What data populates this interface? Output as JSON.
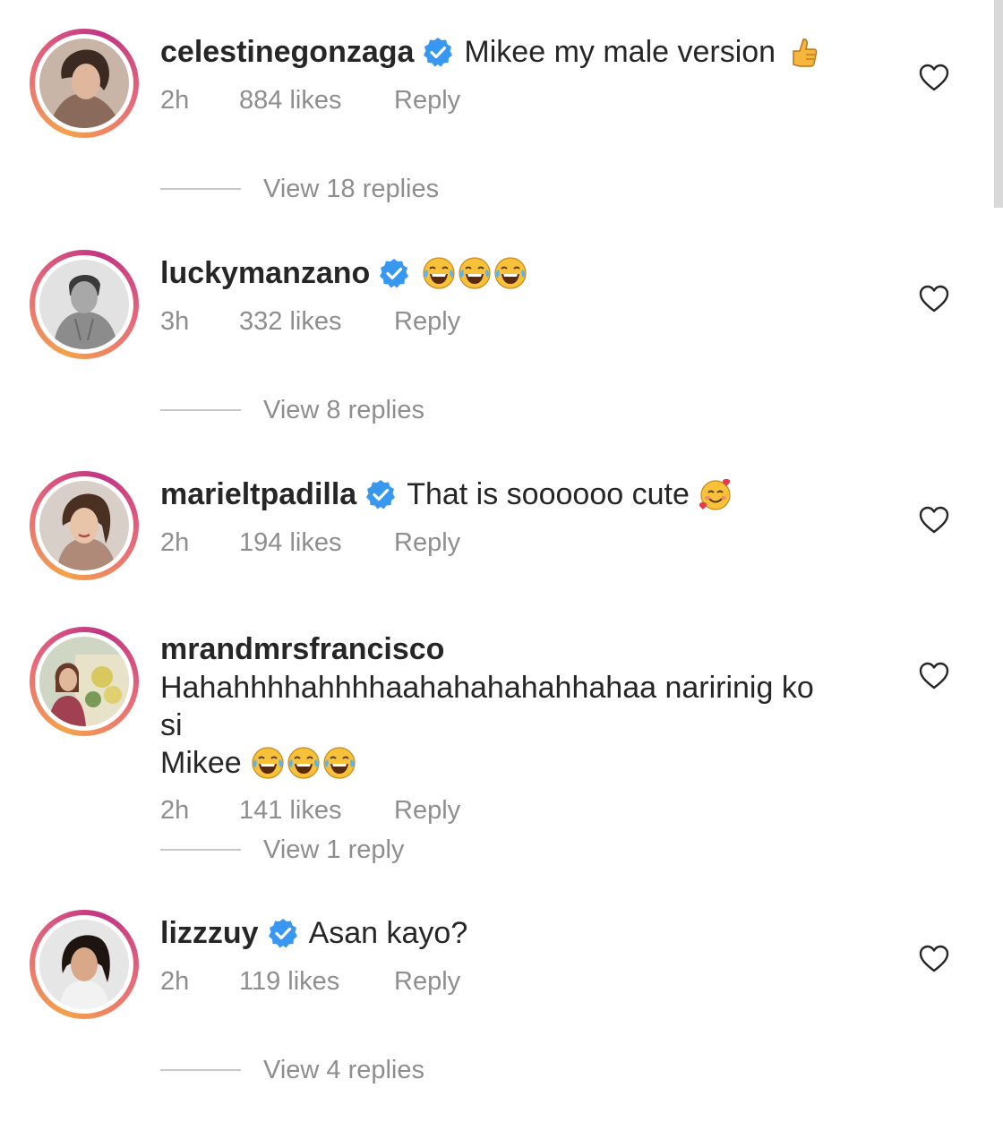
{
  "comments": [
    {
      "username": "celestinegonzaga",
      "verified": true,
      "text": "Mikee my male version",
      "emoji": [
        "thumbs-up"
      ],
      "time": "2h",
      "likes": "884 likes",
      "reply": "Reply",
      "view_replies": "View 18 replies"
    },
    {
      "username": "luckymanzano",
      "verified": true,
      "text": "",
      "emoji": [
        "tears-of-joy",
        "tears-of-joy",
        "tears-of-joy"
      ],
      "time": "3h",
      "likes": "332 likes",
      "reply": "Reply",
      "view_replies": "View 8 replies"
    },
    {
      "username": "marieltpadilla",
      "verified": true,
      "text": "That is soooooo cute",
      "emoji": [
        "smiling-face-with-hearts"
      ],
      "time": "2h",
      "likes": "194 likes",
      "reply": "Reply",
      "view_replies": ""
    },
    {
      "username": "mrandmrsfrancisco",
      "verified": false,
      "text_line1": "Hahahhhhahhhhaahahahahahhahaa naririnig ko si",
      "text_line2": "Mikee",
      "emoji": [
        "tears-of-joy",
        "tears-of-joy",
        "tears-of-joy"
      ],
      "time": "2h",
      "likes": "141 likes",
      "reply": "Reply",
      "view_replies": "View 1 reply"
    },
    {
      "username": "lizzzuy",
      "verified": true,
      "text": "Asan kayo?",
      "emoji": [],
      "time": "2h",
      "likes": "119 likes",
      "reply": "Reply",
      "view_replies": "View 4 replies"
    }
  ],
  "icons": {
    "verified_badge": "verified-badge-icon",
    "like": "heart-outline-icon"
  },
  "colors": {
    "verified_blue": "#3897f0",
    "meta_gray": "#8e8e8e",
    "ring_orange": "#f4a24a",
    "ring_pink": "#c13584"
  }
}
